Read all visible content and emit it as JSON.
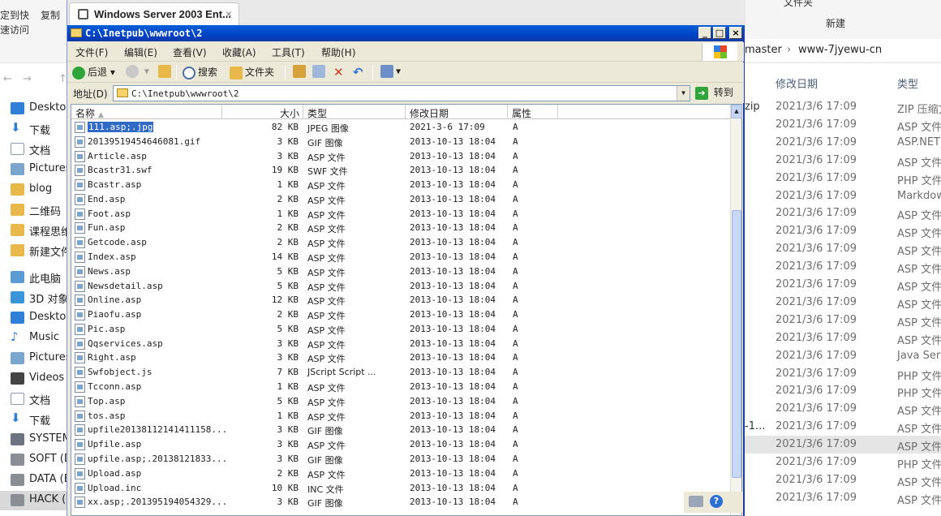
{
  "host": {
    "ribbon_left": [
      "定到快",
      "速访问",
      "复制"
    ],
    "ribbon_right": [
      "文件夹",
      "新建"
    ],
    "nav_arrows": [
      "←",
      "→",
      "↑"
    ],
    "sidebar": [
      {
        "label": "Deskto",
        "icon": "desktop-icon"
      },
      {
        "label": "下载",
        "icon": "download-arrow-icon"
      },
      {
        "label": "文档",
        "icon": "document-icon"
      },
      {
        "label": "Pictures",
        "icon": "pictures-icon"
      },
      {
        "label": "blog",
        "icon": "folder-icon"
      },
      {
        "label": "二维码",
        "icon": "folder-icon"
      },
      {
        "label": "课程思维",
        "icon": "folder-icon"
      },
      {
        "label": "新建文件",
        "icon": "folder-icon"
      },
      {
        "label": "此电脑",
        "icon": "pc-icon"
      },
      {
        "label": "3D 对象",
        "icon": "3d-objects-icon"
      },
      {
        "label": "Deskto",
        "icon": "desktop-icon"
      },
      {
        "label": "Music",
        "icon": "music-icon"
      },
      {
        "label": "Pictures",
        "icon": "pictures-icon"
      },
      {
        "label": "Videos",
        "icon": "videos-icon"
      },
      {
        "label": "文档",
        "icon": "document-icon"
      },
      {
        "label": "下载",
        "icon": "download-arrow-icon"
      },
      {
        "label": "SYSTEM",
        "icon": "system-drive-icon"
      },
      {
        "label": "SOFT (D",
        "icon": "drive-icon"
      },
      {
        "label": "DATA (E",
        "icon": "drive-icon"
      },
      {
        "label": "HACK (",
        "icon": "drive-icon"
      }
    ],
    "breadcrumb": [
      "master",
      "›",
      "www-7jyewu-cn"
    ],
    "columns": {
      "modified": "修改日期",
      "type": "类型"
    },
    "rows": [
      {
        "prefix": "zip",
        "date": "2021/3/6 17:09",
        "type": "ZIP 压缩文"
      },
      {
        "prefix": "",
        "date": "2021/3/6 17:09",
        "type": "ASP 文件"
      },
      {
        "prefix": "",
        "date": "2021/3/6 17:09",
        "type": "ASP.NET"
      },
      {
        "prefix": "",
        "date": "2021/3/6 17:09",
        "type": "ASP 文件"
      },
      {
        "prefix": "",
        "date": "2021/3/6 17:09",
        "type": "PHP 文件"
      },
      {
        "prefix": "",
        "date": "2021/3/6 17:09",
        "type": "Markdow"
      },
      {
        "prefix": "",
        "date": "2021/3/6 17:09",
        "type": "ASP 文件"
      },
      {
        "prefix": "",
        "date": "2021/3/6 17:09",
        "type": "ASP 文件"
      },
      {
        "prefix": "",
        "date": "2021/3/6 17:09",
        "type": "ASP 文件"
      },
      {
        "prefix": "",
        "date": "2021/3/6 17:09",
        "type": "ASP 文件"
      },
      {
        "prefix": "",
        "date": "2021/3/6 17:09",
        "type": "ASP 文件"
      },
      {
        "prefix": "",
        "date": "2021/3/6 17:09",
        "type": "ASP 文件"
      },
      {
        "prefix": "",
        "date": "2021/3/6 17:09",
        "type": "ASP 文件"
      },
      {
        "prefix": "",
        "date": "2021/3/6 17:09",
        "type": "ASP 文件"
      },
      {
        "prefix": "",
        "date": "2021/3/6 17:09",
        "type": "Java Serv"
      },
      {
        "prefix": "",
        "date": "2021/3/6 17:09",
        "type": "PHP 文件"
      },
      {
        "prefix": "",
        "date": "2021/3/6 17:09",
        "type": "PHP 文件"
      },
      {
        "prefix": "",
        "date": "2021/3/6 17:09",
        "type": "ASP 文件"
      },
      {
        "prefix": "-1...",
        "date": "2021/3/6 17:09",
        "type": "ASP 文件"
      },
      {
        "prefix": "",
        "date": "2021/3/6 17:09",
        "type": "ASP 文件"
      },
      {
        "prefix": "",
        "date": "2021/3/6 17:09",
        "type": "PHP 文件"
      },
      {
        "prefix": "",
        "date": "2021/3/6 17:09",
        "type": "ASP 文件"
      },
      {
        "prefix": "",
        "date": "2021/3/6 17:09",
        "type": "ASP 文件"
      }
    ]
  },
  "win": {
    "tab_title": "Windows Server 2003 Ent...",
    "tab_close": "×",
    "title": "C:\\Inetpub\\wwwroot\\2",
    "title_buttons": {
      "min": "_",
      "max": "□",
      "close": "×"
    },
    "menu": [
      "文件(F)",
      "编辑(E)",
      "查看(V)",
      "收藏(A)",
      "工具(T)",
      "帮助(H)"
    ],
    "toolbar": {
      "back": "后退",
      "search": "搜索",
      "folders": "文件夹"
    },
    "address_label": "地址(D)",
    "address_value": "C:\\Inetpub\\wwwroot\\2",
    "go_label": "转到",
    "columns": {
      "name": "名称",
      "size": "大小",
      "type": "类型",
      "modified": "修改日期",
      "attr": "属性"
    },
    "files": [
      {
        "name": "111.asp;.jpg",
        "size": "82 KB",
        "type": "JPEG 图像",
        "date": "2021-3-6 17:09",
        "attr": "A"
      },
      {
        "name": "20139519454646081.gif",
        "size": "3 KB",
        "type": "GIF 图像",
        "date": "2013-10-13 18:04",
        "attr": "A"
      },
      {
        "name": "Article.asp",
        "size": "3 KB",
        "type": "ASP 文件",
        "date": "2013-10-13 18:04",
        "attr": "A"
      },
      {
        "name": "Bcastr31.swf",
        "size": "19 KB",
        "type": "SWF 文件",
        "date": "2013-10-13 18:04",
        "attr": "A"
      },
      {
        "name": "Bcastr.asp",
        "size": "1 KB",
        "type": "ASP 文件",
        "date": "2013-10-13 18:04",
        "attr": "A"
      },
      {
        "name": "End.asp",
        "size": "2 KB",
        "type": "ASP 文件",
        "date": "2013-10-13 18:04",
        "attr": "A"
      },
      {
        "name": "Foot.asp",
        "size": "1 KB",
        "type": "ASP 文件",
        "date": "2013-10-13 18:04",
        "attr": "A"
      },
      {
        "name": "Fun.asp",
        "size": "2 KB",
        "type": "ASP 文件",
        "date": "2013-10-13 18:04",
        "attr": "A"
      },
      {
        "name": "Getcode.asp",
        "size": "2 KB",
        "type": "ASP 文件",
        "date": "2013-10-13 18:04",
        "attr": "A"
      },
      {
        "name": "Index.asp",
        "size": "14 KB",
        "type": "ASP 文件",
        "date": "2013-10-13 18:04",
        "attr": "A"
      },
      {
        "name": "News.asp",
        "size": "5 KB",
        "type": "ASP 文件",
        "date": "2013-10-13 18:04",
        "attr": "A"
      },
      {
        "name": "Newsdetail.asp",
        "size": "5 KB",
        "type": "ASP 文件",
        "date": "2013-10-13 18:04",
        "attr": "A"
      },
      {
        "name": "Online.asp",
        "size": "12 KB",
        "type": "ASP 文件",
        "date": "2013-10-13 18:04",
        "attr": "A"
      },
      {
        "name": "Piaofu.asp",
        "size": "2 KB",
        "type": "ASP 文件",
        "date": "2013-10-13 18:04",
        "attr": "A"
      },
      {
        "name": "Pic.asp",
        "size": "5 KB",
        "type": "ASP 文件",
        "date": "2013-10-13 18:04",
        "attr": "A"
      },
      {
        "name": "Qqservices.asp",
        "size": "3 KB",
        "type": "ASP 文件",
        "date": "2013-10-13 18:04",
        "attr": "A"
      },
      {
        "name": "Right.asp",
        "size": "3 KB",
        "type": "ASP 文件",
        "date": "2013-10-13 18:04",
        "attr": "A"
      },
      {
        "name": "Swfobject.js",
        "size": "7 KB",
        "type": "JScript Script ...",
        "date": "2013-10-13 18:04",
        "attr": "A"
      },
      {
        "name": "Tcconn.asp",
        "size": "1 KB",
        "type": "ASP 文件",
        "date": "2013-10-13 18:04",
        "attr": "A"
      },
      {
        "name": "Top.asp",
        "size": "5 KB",
        "type": "ASP 文件",
        "date": "2013-10-13 18:04",
        "attr": "A"
      },
      {
        "name": "tos.asp",
        "size": "1 KB",
        "type": "ASP 文件",
        "date": "2013-10-13 18:04",
        "attr": "A"
      },
      {
        "name": "upfile20138112141411158...",
        "size": "3 KB",
        "type": "GIF 图像",
        "date": "2013-10-13 18:04",
        "attr": "A"
      },
      {
        "name": "Upfile.asp",
        "size": "3 KB",
        "type": "ASP 文件",
        "date": "2013-10-13 18:04",
        "attr": "A"
      },
      {
        "name": "upfile.asp;.20138121833...",
        "size": "3 KB",
        "type": "GIF 图像",
        "date": "2013-10-13 18:04",
        "attr": "A"
      },
      {
        "name": "Upload.asp",
        "size": "2 KB",
        "type": "ASP 文件",
        "date": "2013-10-13 18:04",
        "attr": "A"
      },
      {
        "name": "Upload.inc",
        "size": "10 KB",
        "type": "INC 文件",
        "date": "2013-10-13 18:04",
        "attr": "A"
      },
      {
        "name": "xx.asp;.201395194054329...",
        "size": "3 KB",
        "type": "GIF 图像",
        "date": "2013-10-13 18:04",
        "attr": "A"
      }
    ],
    "selected_index": 0
  },
  "colors": {
    "selection": "#316ac5",
    "titlebar": "#0042c6",
    "xp_face": "#ece9d8"
  }
}
